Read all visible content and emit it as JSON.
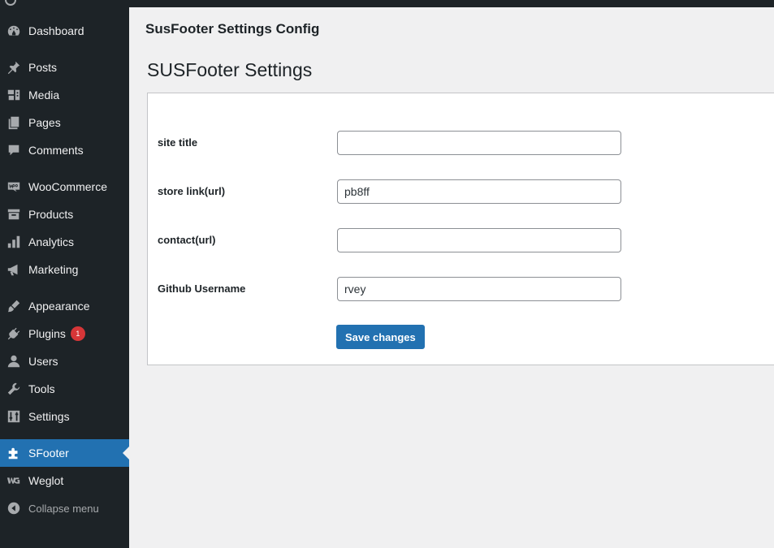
{
  "sidebar": {
    "items": [
      {
        "label": "Dashboard",
        "icon": "dashboard-icon"
      },
      {
        "label": "Posts",
        "icon": "pin-icon"
      },
      {
        "label": "Media",
        "icon": "media-icon"
      },
      {
        "label": "Pages",
        "icon": "pages-icon"
      },
      {
        "label": "Comments",
        "icon": "comment-icon"
      },
      {
        "label": "WooCommerce",
        "icon": "woo-icon"
      },
      {
        "label": "Products",
        "icon": "archive-icon"
      },
      {
        "label": "Analytics",
        "icon": "bar-chart-icon"
      },
      {
        "label": "Marketing",
        "icon": "megaphone-icon"
      },
      {
        "label": "Appearance",
        "icon": "brush-icon"
      },
      {
        "label": "Plugins",
        "icon": "plug-icon",
        "badge": "1"
      },
      {
        "label": "Users",
        "icon": "user-icon"
      },
      {
        "label": "Tools",
        "icon": "wrench-icon"
      },
      {
        "label": "Settings",
        "icon": "sliders-icon"
      },
      {
        "label": "SFooter",
        "icon": "puzzle-icon",
        "current": true
      },
      {
        "label": "Weglot",
        "icon": "weglot-icon"
      }
    ],
    "collapse_label": "Collapse menu"
  },
  "header": {
    "title": "SusFooter Settings Config"
  },
  "main": {
    "section_title": "SUSFooter Settings",
    "fields": [
      {
        "label": "site title",
        "value": ""
      },
      {
        "label": "store link(url)",
        "value": "pb8ff"
      },
      {
        "label": "contact(url)",
        "value": ""
      },
      {
        "label": "Github Username",
        "value": "rvey"
      }
    ],
    "save_label": "Save changes"
  },
  "colors": {
    "sidebar_bg": "#1d2327",
    "accent": "#2271b1",
    "badge": "#d63638",
    "page_bg": "#f0f0f1"
  }
}
